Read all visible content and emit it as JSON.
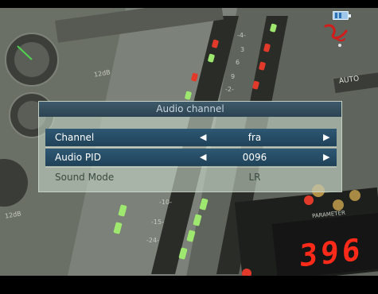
{
  "dialog": {
    "title": "Audio channel",
    "rows": [
      {
        "label": "Channel",
        "value": "fra",
        "state": "active",
        "has_arrows": true
      },
      {
        "label": "Audio PID",
        "value": "0096",
        "state": "active",
        "has_arrows": true
      },
      {
        "label": "Sound Mode",
        "value": "LR",
        "state": "disabled",
        "has_arrows": false
      }
    ]
  },
  "icons": {
    "left": "arrow-left-icon",
    "right": "arrow-right-icon",
    "battery": "battery-icon",
    "logo": "virgin-logo-icon"
  },
  "background": {
    "display_digits": "396",
    "scale_marks": [
      "12dB",
      "12dB",
      "-10-",
      "-15-",
      "-24-",
      "3",
      "6",
      "9",
      "-2-",
      "-4-"
    ],
    "panel_text": [
      "AUTO",
      "PARAMETER"
    ]
  },
  "colors": {
    "dialog_title_bg": "#2c4352",
    "active_row_bg": "#1f4258",
    "disabled_text": "#3a4a40",
    "led_green": "#9fe870",
    "led_red": "#e23a2a",
    "display_red": "#ff2a1a"
  }
}
